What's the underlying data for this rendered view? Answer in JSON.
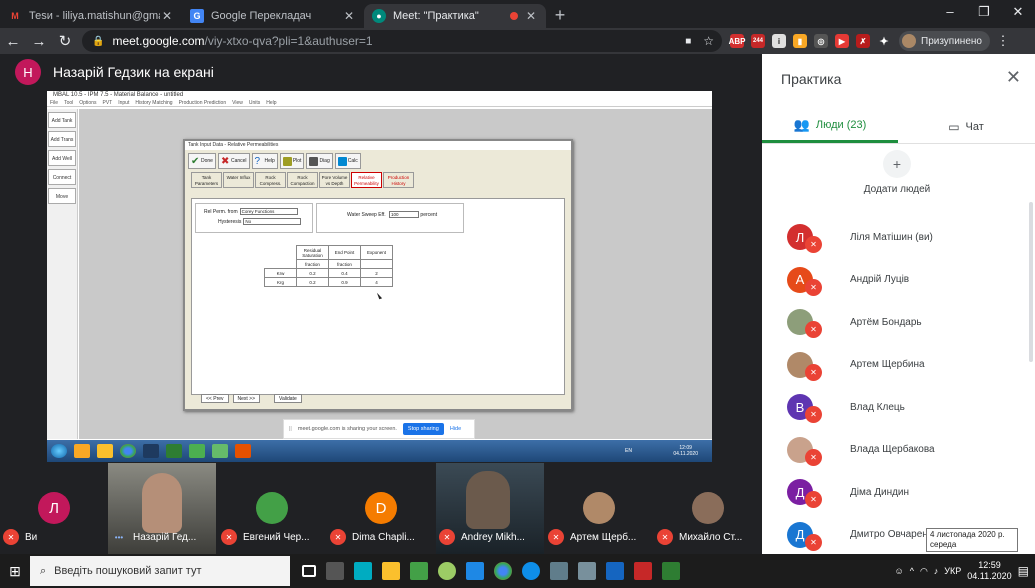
{
  "browser": {
    "tabs": [
      {
        "title": "Теsи - liliya.matishun@gmail.com",
        "favicon": "gmail-icon",
        "color": "#ea4335",
        "glyph": "M"
      },
      {
        "title": "Google Перекладач",
        "favicon": "translate-icon",
        "color": "#4285f4",
        "glyph": "G"
      },
      {
        "title": "Meet: \"Практика\"",
        "favicon": "meet-icon",
        "color": "#00897b",
        "glyph": "●"
      }
    ],
    "url_host": "meet.google.com",
    "url_path": "/viy-xtxo-qva?pli=1&authuser=1",
    "profile_label": "Призупинено",
    "ext_badge": "244"
  },
  "presenter": {
    "initial": "Н",
    "text": "Назарій Гедзик на екрані"
  },
  "shared_screen": {
    "app_title": "MBAL 10.5 - IPM 7.5 - Material Balance - untitled",
    "menu": [
      "File",
      "Tool",
      "Options",
      "PVT",
      "Input",
      "History Matching",
      "Production Prediction",
      "View",
      "Units",
      "Help"
    ],
    "left_buttons": [
      "Add Tank",
      "Add Trans",
      "Add Well",
      "Connect",
      "Move"
    ],
    "dialog_title": "Tank Input Data - Relative Permeabilities",
    "toolbar": [
      "Done",
      "Cancel",
      "Help",
      "Plot",
      "Diag",
      "Calc"
    ],
    "tabs": [
      "Tank Parameters",
      "Water Influx",
      "Rock Compress.",
      "Rock Compaction",
      "Pore Volume vs Depth",
      "Relative Permeability",
      "Production History"
    ],
    "rel_perm_from_label": "Rel Perm. from",
    "rel_perm_from_value": "Corey Functions",
    "hysteresis_label": "Hysteresis",
    "hysteresis_value": "No",
    "water_sweep_label": "Water Sweep Eff.",
    "water_sweep_value": "100",
    "water_sweep_unit": "percent",
    "table_headers": [
      "Residual Saturation",
      "End Point",
      "Exponent"
    ],
    "table_units": [
      "fraction",
      "fraction",
      ""
    ],
    "table_rows": [
      {
        "label": "Krw",
        "values": [
          "0.2",
          "0.4",
          "2"
        ]
      },
      {
        "label": "Krg",
        "values": [
          "0.2",
          "0.9",
          "4"
        ]
      }
    ],
    "nav": [
      "<< Prev",
      "Next >>",
      "Validate"
    ],
    "sharebar_text": "meet.google.com is sharing your screen.",
    "sharebar_stop": "Stop sharing",
    "sharebar_hide": "Hide",
    "inner_clock_time": "12:09",
    "inner_clock_date": "04.11.2020",
    "inner_lang": "EN"
  },
  "panel": {
    "title": "Практика",
    "tab_people": "Люди (23)",
    "tab_chat": "Чат",
    "add_people": "Додати людей",
    "participants": [
      {
        "name": "Ліля Матішин (ви)",
        "initial": "Л",
        "color": "#d32f2f"
      },
      {
        "name": "Андрій Луців",
        "initial": "А",
        "color": "#e64a19"
      },
      {
        "name": "Артём Бондарь",
        "initial": "",
        "color": "#8d9e7a"
      },
      {
        "name": "Артем Щербина",
        "initial": "",
        "color": "#b08968"
      },
      {
        "name": "Влад Клець",
        "initial": "В",
        "color": "#5e35b1"
      },
      {
        "name": "Влада Щербакова",
        "initial": "",
        "color": "#c9a28c"
      },
      {
        "name": "Діма Диндин",
        "initial": "Д",
        "color": "#7b1fa2"
      },
      {
        "name": "Дмитро Овчарен",
        "initial": "Д",
        "color": "#1976d2"
      }
    ]
  },
  "tooltip": {
    "line1": "4 листопада 2020 р.",
    "line2": "середа"
  },
  "tiles": [
    {
      "name": "Ви",
      "initial": "Л",
      "color": "#c2185b",
      "video": false
    },
    {
      "name": "Назарій Гед...",
      "initial": "",
      "color": "",
      "video": true
    },
    {
      "name": "Евгений Чер...",
      "initial": "",
      "color": "#43a047",
      "video": false
    },
    {
      "name": "Dima Chapli...",
      "initial": "D",
      "color": "#f57c00",
      "video": false
    },
    {
      "name": "Andrey Mikh...",
      "initial": "",
      "color": "",
      "video": true
    },
    {
      "name": "Артем Щерб...",
      "initial": "",
      "color": "#b08968",
      "video": false
    },
    {
      "name": "Михайло Ст...",
      "initial": "",
      "color": "#8a6d5a",
      "video": false
    }
  ],
  "taskbar": {
    "search_placeholder": "Введіть пошуковий запит тут",
    "lang": "УКР",
    "time": "12:59",
    "date": "04.11.2020"
  }
}
